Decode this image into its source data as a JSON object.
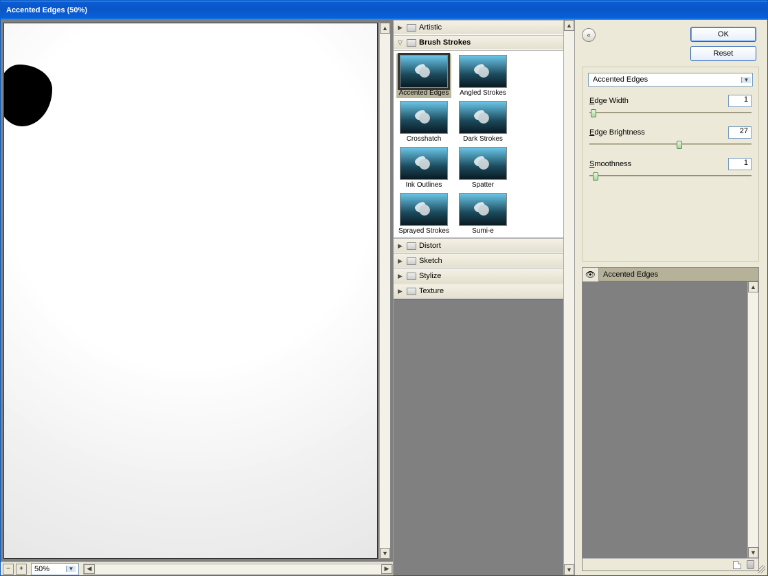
{
  "window": {
    "title": "Accented Edges (50%)"
  },
  "zoom": {
    "minus": "−",
    "plus": "+",
    "value": "50%"
  },
  "categories": [
    {
      "label": "Artistic",
      "open": false
    },
    {
      "label": "Brush Strokes",
      "open": true,
      "bold": true
    },
    {
      "label": "Distort",
      "open": false
    },
    {
      "label": "Sketch",
      "open": false
    },
    {
      "label": "Stylize",
      "open": false
    },
    {
      "label": "Texture",
      "open": false
    }
  ],
  "thumbs": [
    {
      "label": "Accented Edges",
      "selected": true
    },
    {
      "label": "Angled Strokes"
    },
    {
      "label": "Crosshatch"
    },
    {
      "label": "Dark Strokes"
    },
    {
      "label": "Ink Outlines"
    },
    {
      "label": "Spatter"
    },
    {
      "label": "Sprayed Strokes"
    },
    {
      "label": "Sumi-e"
    }
  ],
  "buttons": {
    "ok": "OK",
    "reset": "Reset"
  },
  "filterSelect": "Accented Edges",
  "params": [
    {
      "label": "Edge Width",
      "value": "1",
      "pos": 1
    },
    {
      "label": "Edge Brightness",
      "value": "27",
      "pos": 54
    },
    {
      "label": "Smoothness",
      "value": "1",
      "pos": 2
    }
  ],
  "layer": {
    "name": "Accented Edges"
  }
}
